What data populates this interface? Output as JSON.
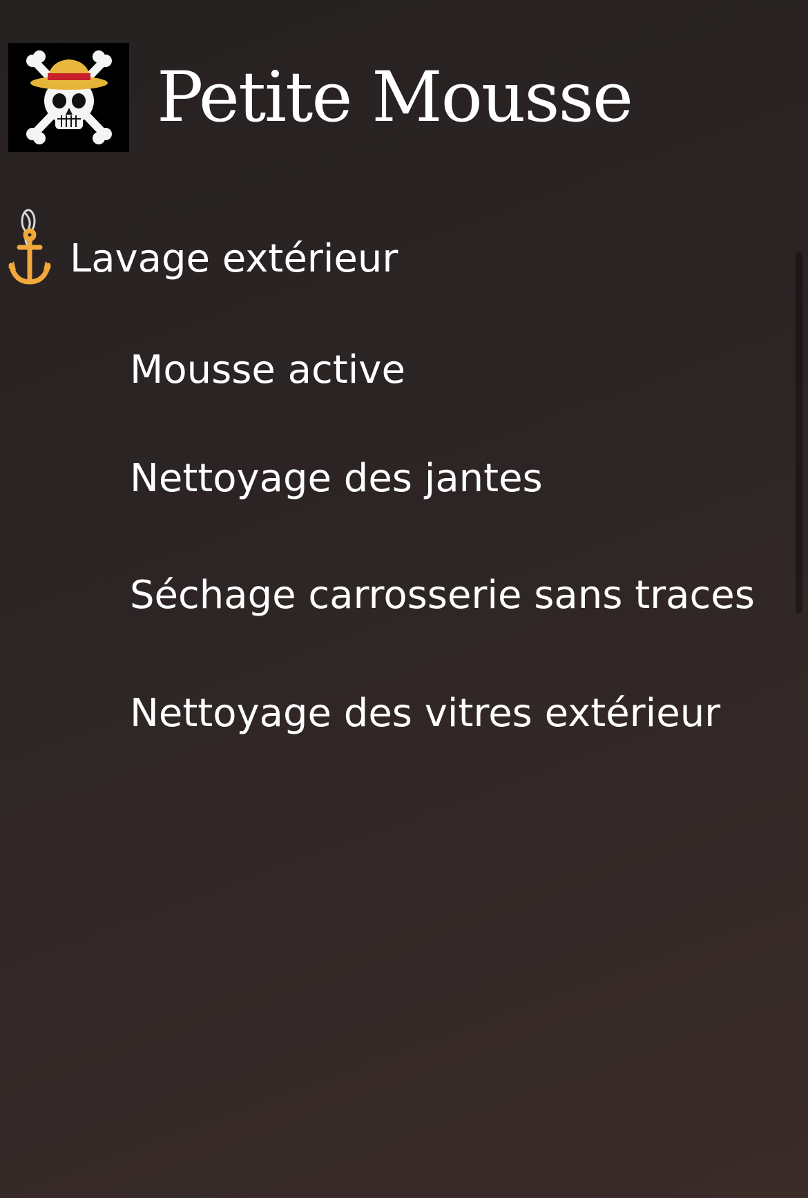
{
  "header": {
    "logo_icon": "straw-hat-jolly-roger-icon",
    "title": "Petite Mousse"
  },
  "section": {
    "icon": "anchor-icon",
    "title": "Lavage extérieur",
    "accent": "#f2a83b",
    "items": [
      {
        "label": "Mousse active"
      },
      {
        "label": "Nettoyage des jantes"
      },
      {
        "label": "Séchage carrosserie sans traces"
      },
      {
        "label": "Nettoyage des vitres extérieur"
      }
    ]
  }
}
